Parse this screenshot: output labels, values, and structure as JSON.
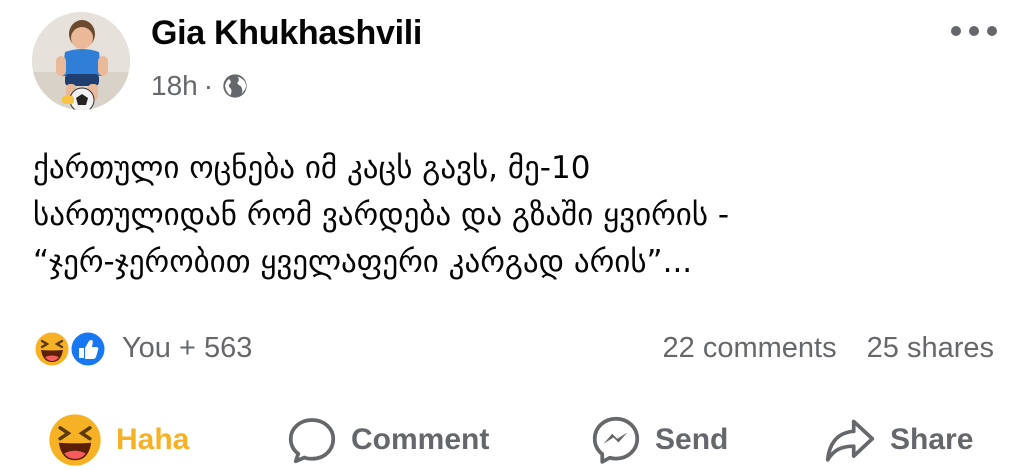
{
  "post": {
    "author": "Gia Khukhashvili",
    "time": "18h",
    "separator": "·",
    "privacy_icon": "globe-icon",
    "menu_icon": "more-options-icon",
    "text_lines": [
      "ქართული ოცნება იმ კაცს გავს, მე-10",
      "სართულიდან რომ ვარდება და გზაში ყვირის  -",
      "“ჯერ-ჯერობით ყველაფერი კარგად არის”..."
    ]
  },
  "stats": {
    "reaction_icons": [
      "haha-reaction-icon",
      "like-reaction-icon"
    ],
    "reactions_label": "You + 563",
    "comments_label": "22 comments",
    "shares_label": "25 shares"
  },
  "actions": {
    "haha_label": "Haha",
    "comment_label": "Comment",
    "send_label": "Send",
    "share_label": "Share"
  },
  "colors": {
    "text_primary": "#050505",
    "text_secondary": "#65676b",
    "haha_yellow": "#f7b125",
    "like_blue": "#1877f2"
  }
}
